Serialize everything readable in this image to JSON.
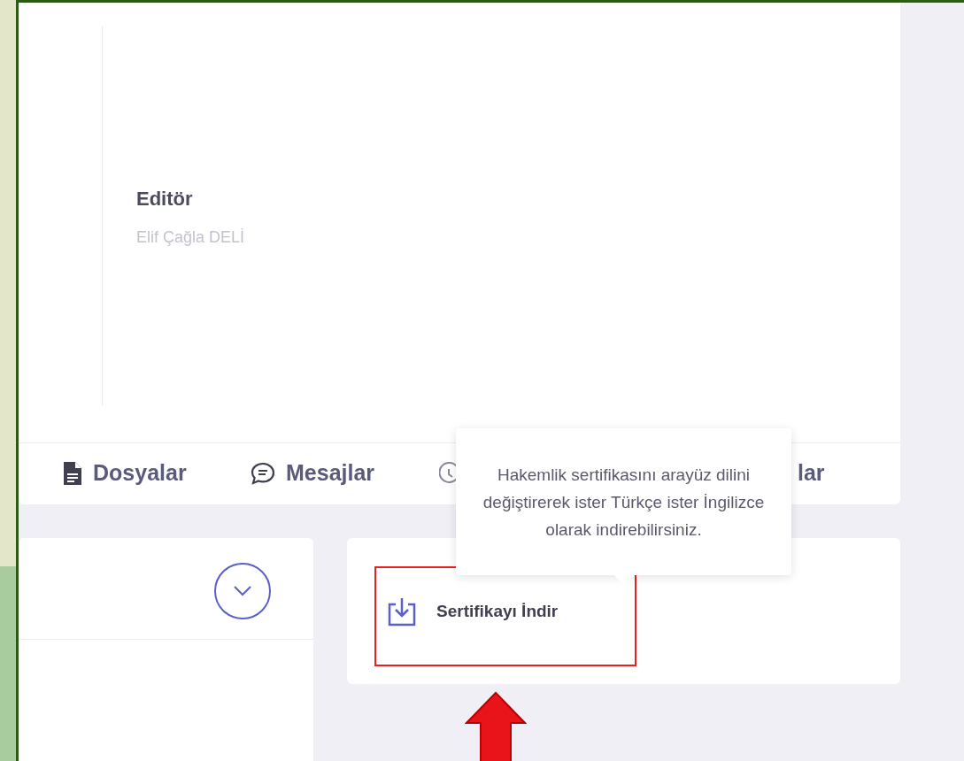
{
  "editor": {
    "label": "Editör",
    "name": "Elif Çağla DELİ"
  },
  "tabs": [
    {
      "kind": "files",
      "label": "Dosyalar"
    },
    {
      "kind": "messages",
      "label": "Mesajlar"
    },
    {
      "kind": "clock"
    },
    {
      "kind": "hidden",
      "label": "lar"
    }
  ],
  "tooltip": {
    "text": "Hakemlik sertifikasını arayüz dilini değiştirerek ister Türkçe ister İngilizce olarak indirebilirsiniz."
  },
  "certificate_button": {
    "label": "Sertifikayı İndir"
  }
}
